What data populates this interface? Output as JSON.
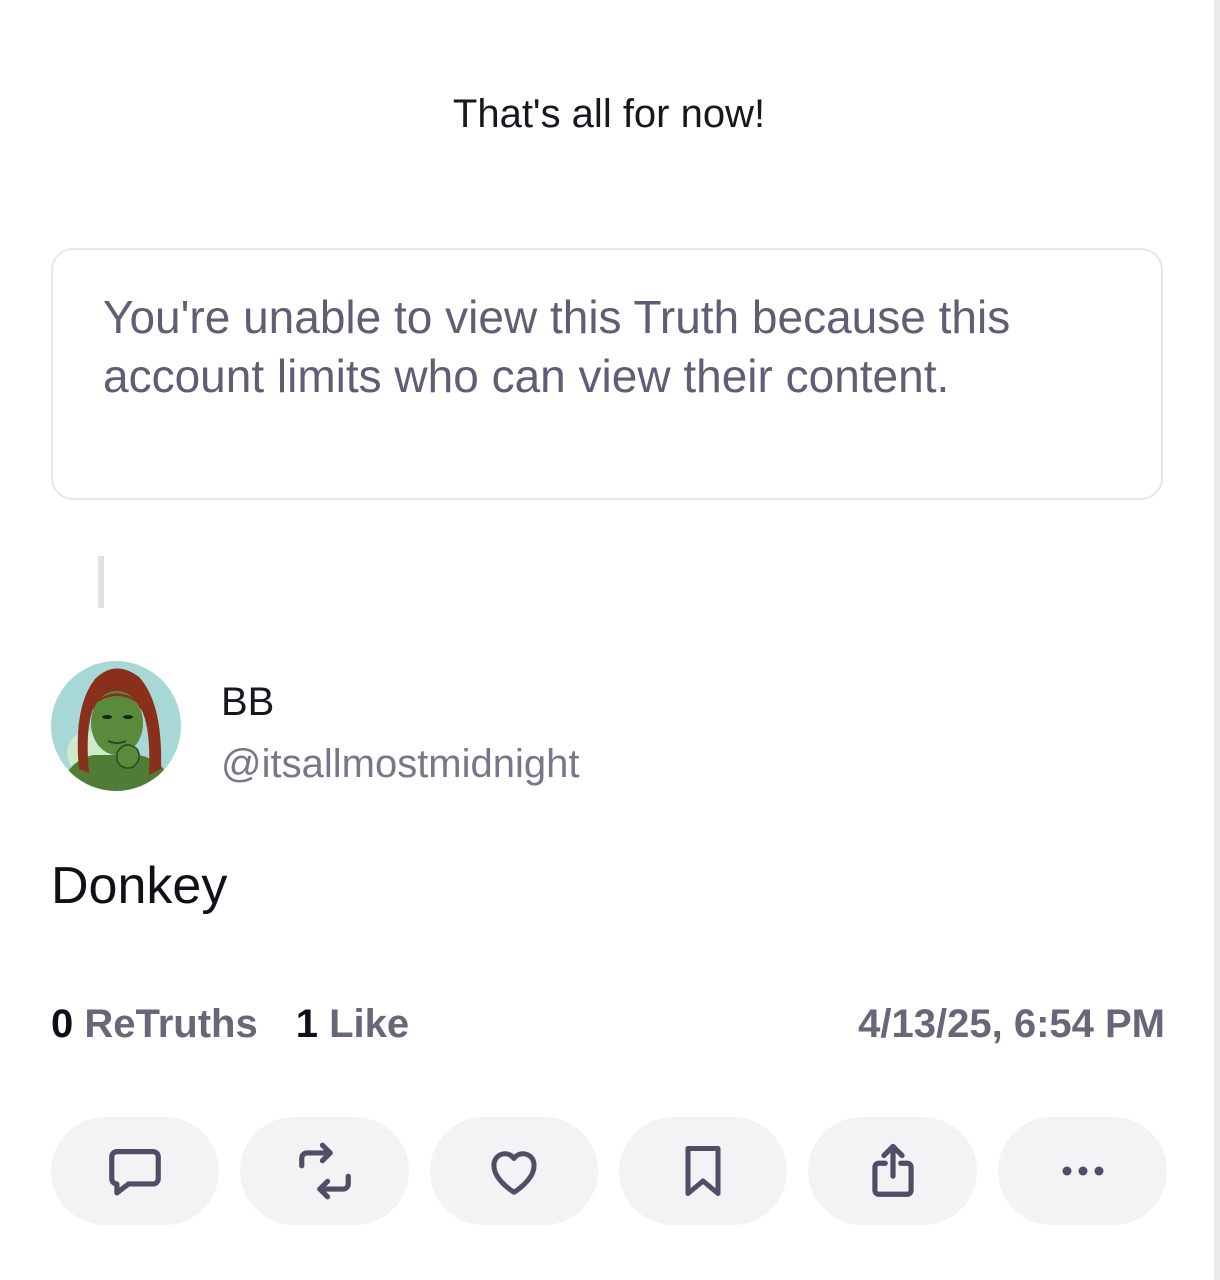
{
  "feed": {
    "end_message": "That's all for now!"
  },
  "blocked_notice": {
    "text": "You're unable to view this Truth because this account limits who can view their content."
  },
  "post": {
    "author": {
      "display_name": "BB",
      "handle": "@itsallmostmidnight",
      "avatar_icon": "avatar-image"
    },
    "content": "Donkey",
    "stats": {
      "retruths_count": "0",
      "retruths_label": "ReTruths",
      "likes_count": "1",
      "likes_label": "Like"
    },
    "timestamp": "4/13/25, 6:54 PM"
  },
  "actions": [
    {
      "name": "reply",
      "icon": "comment-icon"
    },
    {
      "name": "retruth",
      "icon": "repost-icon"
    },
    {
      "name": "like",
      "icon": "heart-icon"
    },
    {
      "name": "bookmark",
      "icon": "bookmark-icon"
    },
    {
      "name": "share",
      "icon": "share-icon"
    },
    {
      "name": "more",
      "icon": "more-icon"
    }
  ],
  "colors": {
    "text_primary": "#0f0f1a",
    "text_secondary": "#5e5e74",
    "button_bg": "#f3f3f5",
    "icon": "#4e4e65",
    "card_border": "#e6e6eb"
  }
}
